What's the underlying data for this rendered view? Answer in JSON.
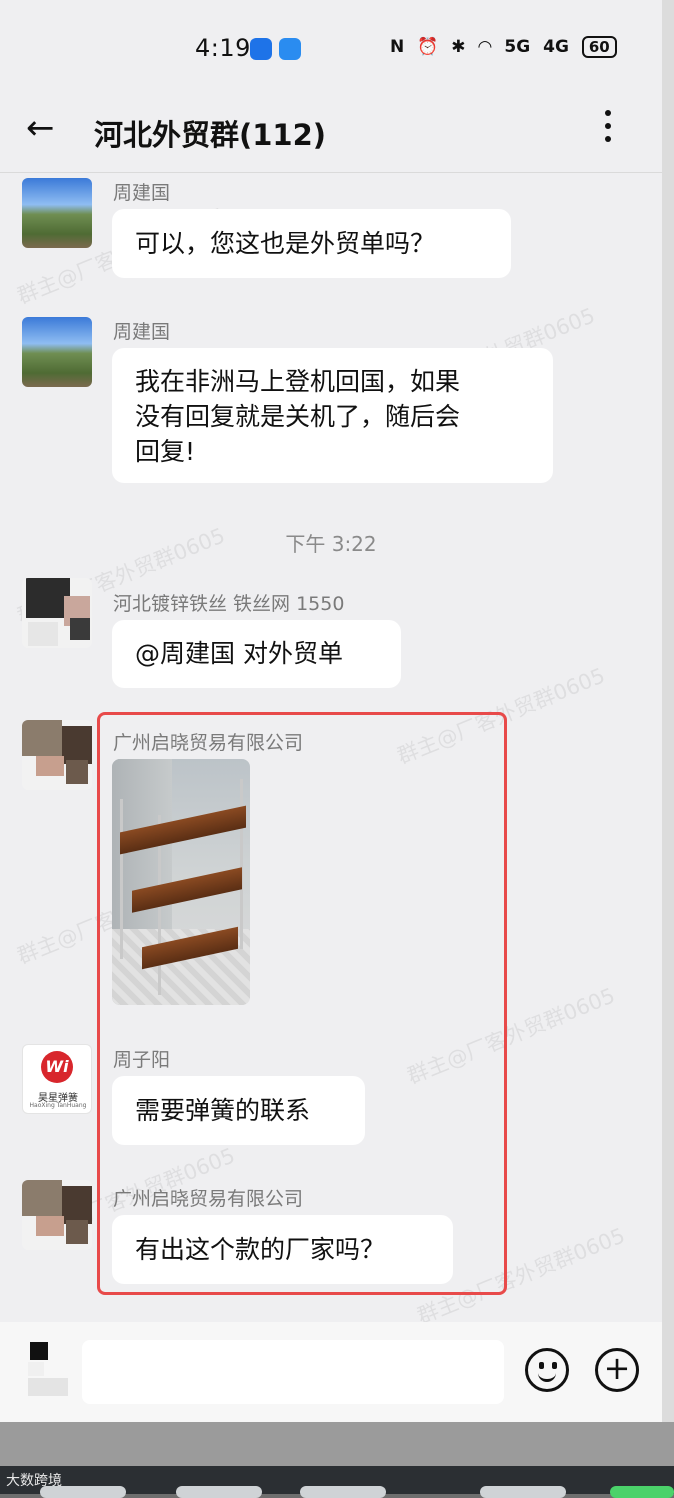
{
  "status_bar": {
    "time": "4:19",
    "network_1": "5G",
    "network_2": "4G",
    "battery": "60"
  },
  "header": {
    "back_icon": "←",
    "title": "河北外贸群(112)"
  },
  "watermark_text": "群主@厂客外贸群0605",
  "messages": [
    {
      "sender": "周建国",
      "text_lines": [
        "可以，您这也是外贸单吗？"
      ]
    },
    {
      "sender": "周建国",
      "text_lines": [
        "我在非洲马上登机回国，如果",
        "没有回复就是关机了，随后会",
        "回复!"
      ]
    },
    {
      "timestamp": "下午 3:22"
    },
    {
      "sender": "河北镀锌铁丝 铁丝网 1550",
      "text_lines": [
        "@周建国 对外贸单"
      ]
    },
    {
      "sender": "广州启晓贸易有限公司",
      "image": "metal-shelf-photo"
    },
    {
      "sender": "周子阳",
      "text_lines": [
        "需要弹簧的联系"
      ],
      "avatar_logo": {
        "mark": "Wi",
        "text": "昊星弹簧",
        "sub": "HaoXing TanHuang"
      }
    },
    {
      "sender": "广州启晓贸易有限公司",
      "text_lines": [
        "有出这个款的厂家吗？"
      ]
    }
  ],
  "input_bar": {
    "emoji_icon": "smiley-icon",
    "plus_icon": "+"
  },
  "bottom_bar": {
    "brand": "大数跨境"
  },
  "colors": {
    "highlight_border": "#e84a4a",
    "background": "#efeff1",
    "bubble": "#ffffff"
  }
}
